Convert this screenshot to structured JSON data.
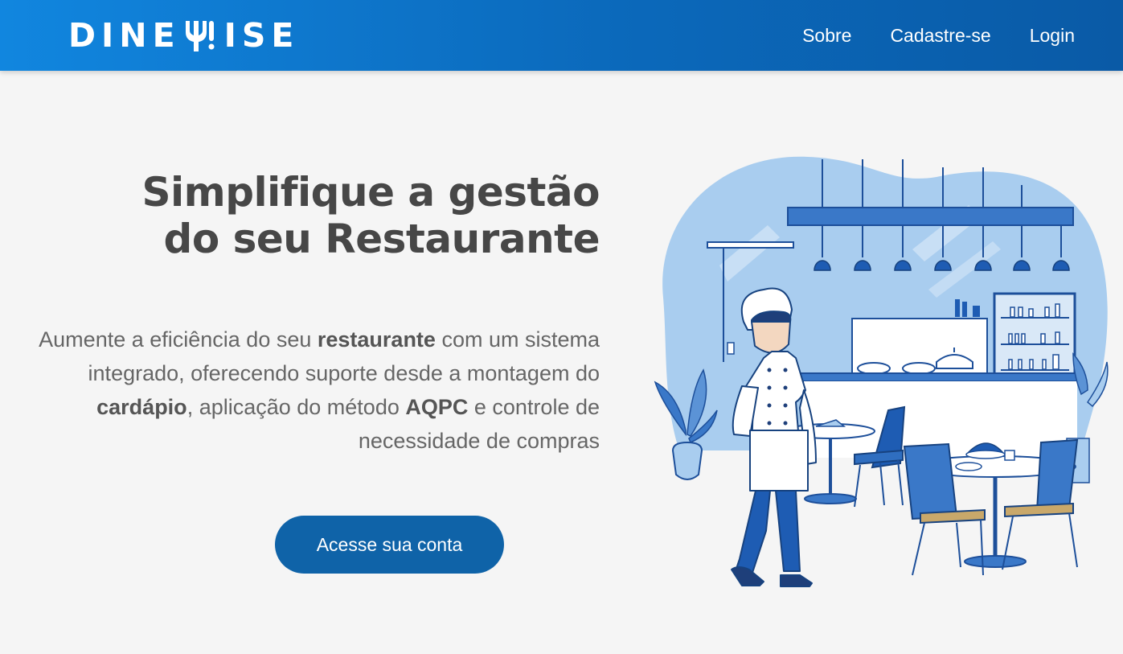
{
  "brand": {
    "name_left": "DINE",
    "name_right": "ISE",
    "primary_color": "#0b69bb",
    "accent_color": "#1186df"
  },
  "nav": {
    "items": [
      {
        "label": "Sobre"
      },
      {
        "label": "Cadastre-se"
      },
      {
        "label": "Login"
      }
    ]
  },
  "hero": {
    "title_line1": "Simplifique a gestão",
    "title_line2": "do seu Restaurante",
    "desc": {
      "p1": "Aumente a eficiência do seu ",
      "b1": "restaurante",
      "p2": " com um sistema integrado, oferecendo suporte desde a montagem do ",
      "b2": "cardápio",
      "p3": ", aplicação do método ",
      "b3": "AQPC",
      "p4": " e controle de necessidade de compras"
    },
    "cta_label": "Acesse sua conta"
  },
  "illustration": {
    "icon": "chef-restaurant-illustration"
  }
}
